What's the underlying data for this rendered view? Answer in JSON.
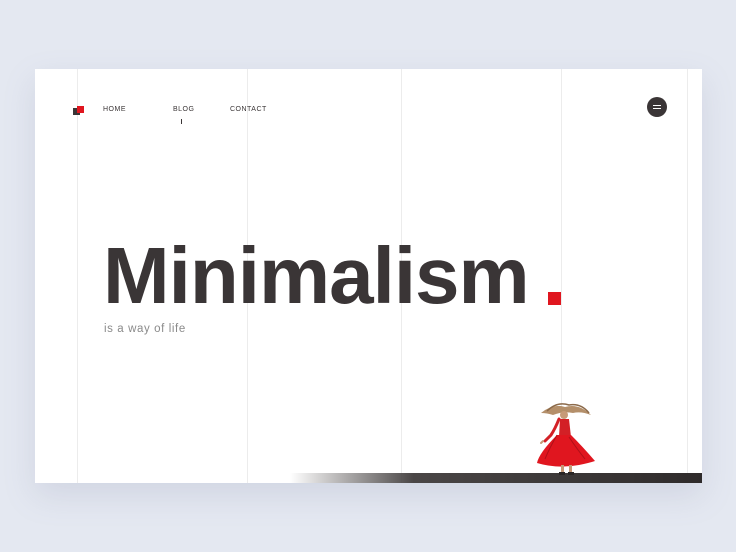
{
  "nav": {
    "items": [
      {
        "label": "HOME"
      },
      {
        "label": "BLOG"
      },
      {
        "label": "CONTACT"
      }
    ]
  },
  "hero": {
    "title": "Minimalism",
    "tagline": "is a way of life"
  },
  "icons": {
    "logo": "logo-squares-icon",
    "menu": "hamburger-menu-icon"
  },
  "colors": {
    "accent": "#e0161f",
    "text_dark": "#3a3536",
    "text_muted": "#8a8a8a",
    "background": "#e4e8f1",
    "card": "#ffffff"
  }
}
